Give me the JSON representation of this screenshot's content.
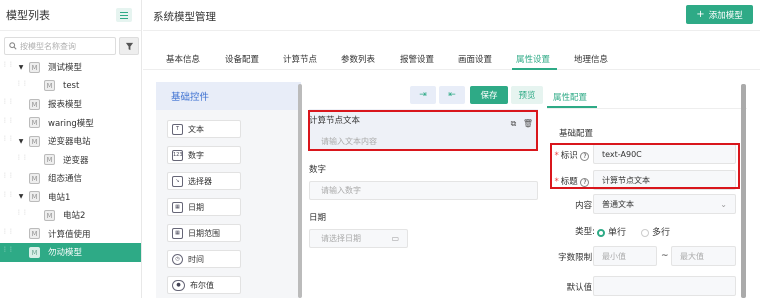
{
  "sidebar": {
    "title": "模型列表",
    "search_placeholder": "按模型名称查询",
    "tree": [
      {
        "label": "测试模型",
        "level": 0,
        "expanded": true,
        "selected": false
      },
      {
        "label": "test",
        "level": 1,
        "selected": false
      },
      {
        "label": "报表模型",
        "level": 0,
        "selected": false
      },
      {
        "label": "waring模型",
        "level": 0,
        "selected": false
      },
      {
        "label": "逆变器电站",
        "level": 0,
        "expanded": true,
        "selected": false
      },
      {
        "label": "逆变器",
        "level": 1,
        "selected": false
      },
      {
        "label": "组态通信",
        "level": 0,
        "selected": false
      },
      {
        "label": "电站1",
        "level": 0,
        "expanded": true,
        "selected": false
      },
      {
        "label": "电站2",
        "level": 1,
        "selected": false
      },
      {
        "label": "计算值使用",
        "level": 0,
        "selected": false
      },
      {
        "label": "勿动模型",
        "level": 0,
        "selected": true
      }
    ]
  },
  "header": {
    "title": "系统模型管理",
    "add_label": "添加模型"
  },
  "tabs": [
    {
      "label": "基本信息"
    },
    {
      "label": "设备配置"
    },
    {
      "label": "计算节点"
    },
    {
      "label": "参数列表"
    },
    {
      "label": "报警设置"
    },
    {
      "label": "画面设置"
    },
    {
      "label": "属性设置",
      "active": true
    },
    {
      "label": "地理信息"
    }
  ],
  "palette": {
    "title": "基础控件",
    "items": [
      {
        "label": "文本",
        "icon": "text-icon"
      },
      {
        "label": "数字",
        "icon": "number-icon"
      },
      {
        "label": "选择器",
        "icon": "select-icon"
      },
      {
        "label": "日期",
        "icon": "calendar-icon"
      },
      {
        "label": "日期范围",
        "icon": "date-range-icon"
      },
      {
        "label": "时间",
        "icon": "clock-icon"
      },
      {
        "label": "布尔值",
        "icon": "toggle-icon"
      }
    ]
  },
  "canvas": {
    "save_label": "保存",
    "preview_label": "预览",
    "fields": [
      {
        "label": "计算节点文本",
        "placeholder": "请输入文本内容"
      },
      {
        "label": "数字",
        "placeholder": "请输入数字"
      },
      {
        "label": "日期",
        "placeholder": "请选择日期"
      }
    ]
  },
  "properties": {
    "tab_label": "属性配置",
    "section": "基础配置",
    "id_label": "标识",
    "id_value": "text-A90C",
    "title_label": "标题",
    "title_value": "计算节点文本",
    "content_label": "内容:",
    "content_value": "普通文本",
    "type_label": "类型:",
    "type_single": "单行",
    "type_multi": "多行",
    "limit_label": "字数限制:",
    "min_placeholder": "最小值",
    "max_placeholder": "最大值",
    "range_sep": "~",
    "default_label": "默认值:"
  },
  "colors": {
    "accent": "#2eaa86",
    "highlight": "#d9161c",
    "palette_head": "#3b6fd1"
  }
}
